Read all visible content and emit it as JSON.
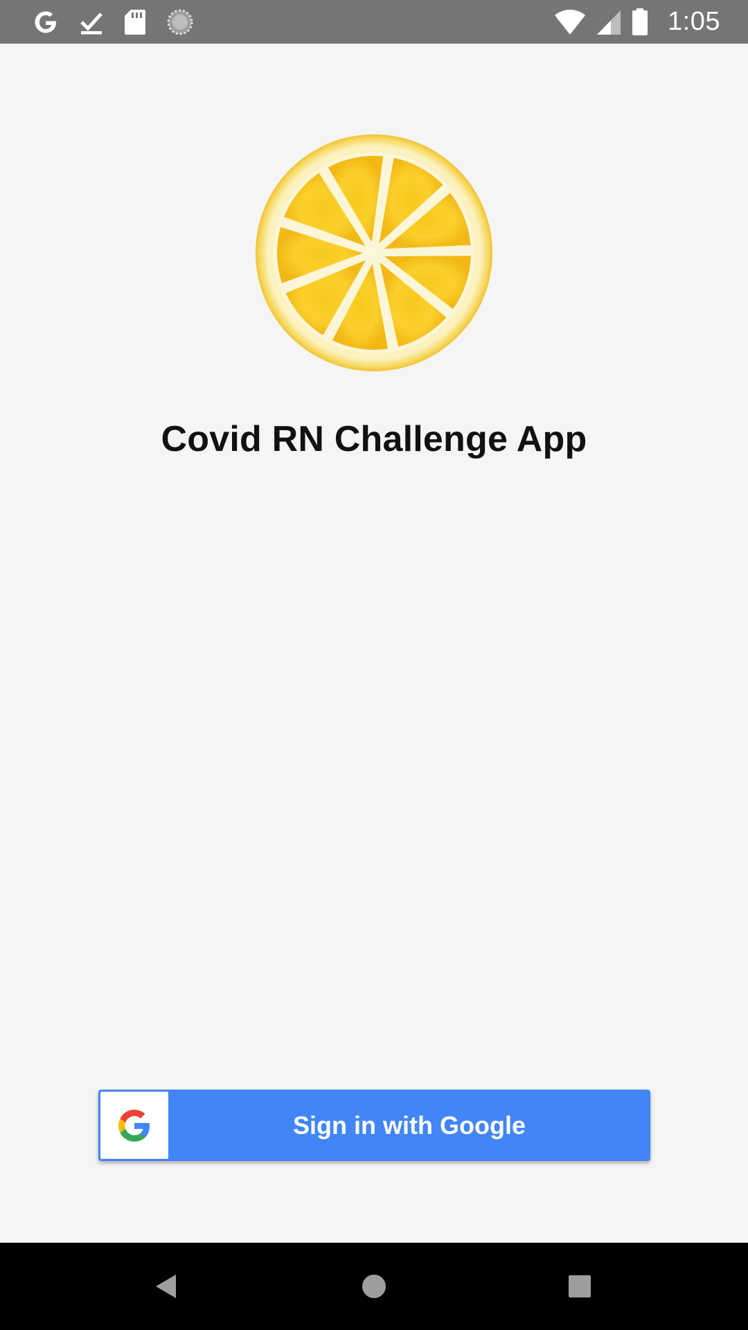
{
  "status_bar": {
    "time": "1:05",
    "left_icons": [
      "google-g-icon",
      "download-done-icon",
      "sd-card-icon",
      "loading-spinner-icon"
    ],
    "right_icons": [
      "wifi-icon",
      "cell-signal-icon",
      "battery-icon"
    ]
  },
  "app": {
    "title": "Covid RN Challenge App",
    "logo": "lemon-slice-icon"
  },
  "sign_in_button": {
    "label": "Sign in with Google",
    "icon": "google-logo-icon",
    "color": "#4285f4"
  },
  "navigation_bar": {
    "buttons": [
      "back-icon",
      "home-icon",
      "recents-icon"
    ]
  },
  "colors": {
    "background": "#f5f5f5",
    "status_bar": "#757575",
    "nav_bar": "#000000",
    "google_blue": "#4285f4"
  }
}
